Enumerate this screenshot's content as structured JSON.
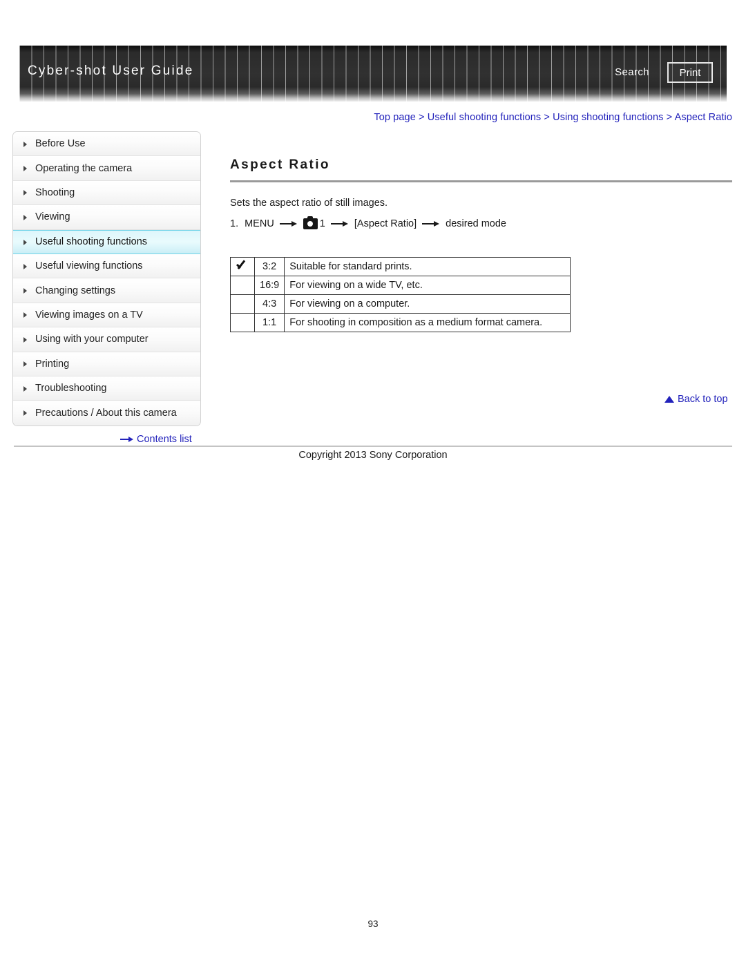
{
  "header": {
    "title": "Cyber-shot User Guide",
    "search_label": "Search",
    "print_label": "Print"
  },
  "breadcrumb": {
    "items": [
      "Top page",
      "Useful shooting functions",
      "Using shooting functions",
      "Aspect Ratio"
    ],
    "separator": ">"
  },
  "sidebar": {
    "items": [
      {
        "label": "Before Use",
        "active": false
      },
      {
        "label": "Operating the camera",
        "active": false
      },
      {
        "label": "Shooting",
        "active": false
      },
      {
        "label": "Viewing",
        "active": false
      },
      {
        "label": "Useful shooting functions",
        "active": true
      },
      {
        "label": "Useful viewing functions",
        "active": false
      },
      {
        "label": "Changing settings",
        "active": false
      },
      {
        "label": "Viewing images on a TV",
        "active": false
      },
      {
        "label": "Using with your computer",
        "active": false
      },
      {
        "label": "Printing",
        "active": false
      },
      {
        "label": "Troubleshooting",
        "active": false
      },
      {
        "label": "Precautions / About this camera",
        "active": false
      }
    ],
    "contents_link": "Contents list"
  },
  "main": {
    "title": "Aspect Ratio",
    "intro": "Sets the aspect ratio of still images.",
    "step": {
      "number": "1.",
      "menu_label": "MENU",
      "camera_tab": "1",
      "item_label": "[Aspect Ratio]",
      "result_label": "desired mode"
    },
    "table": {
      "rows": [
        {
          "checked": true,
          "ratio": "3:2",
          "description": "Suitable for standard prints."
        },
        {
          "checked": false,
          "ratio": "16:9",
          "description": "For viewing on a wide TV, etc."
        },
        {
          "checked": false,
          "ratio": "4:3",
          "description": "For viewing on a computer."
        },
        {
          "checked": false,
          "ratio": "1:1",
          "description": "For shooting in composition as a medium format camera."
        }
      ]
    },
    "back_to_top": "Back to top"
  },
  "footer": {
    "copyright": "Copyright 2013 Sony Corporation",
    "page_number": "93"
  },
  "colors": {
    "link": "#2222bb",
    "active_highlight": "#ddf6fb",
    "active_border": "#6fd3e8",
    "banner_dark": "#2b2b2b"
  }
}
